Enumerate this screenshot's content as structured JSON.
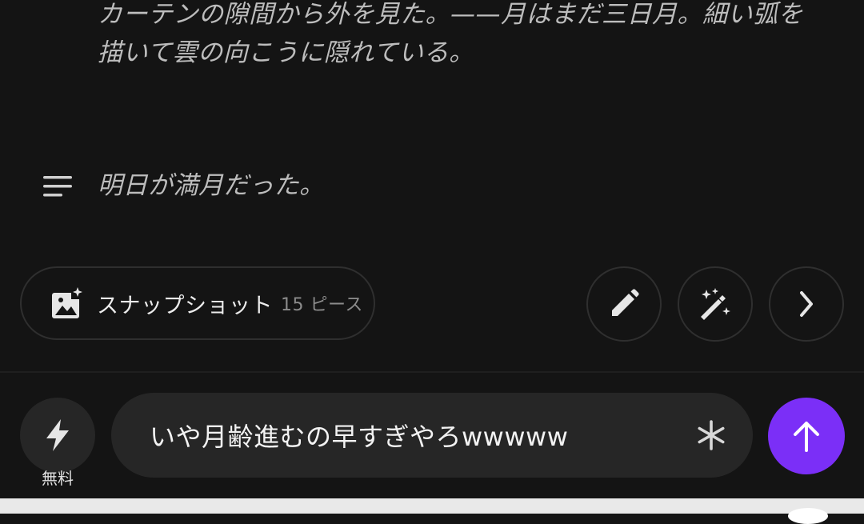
{
  "story": {
    "paragraph1": "カーテンの隙間から外を見た。——月はまだ三日月。細い弧を描いて雲の向こうに隠れている。",
    "paragraph2": "明日が満月だった。",
    "paragraph2_icon": "lines-icon"
  },
  "toolbar": {
    "snapshot": {
      "icon": "image-sparkle-icon",
      "label": "スナップショット",
      "count": "15 ピース"
    },
    "edit_icon": "pencil-icon",
    "magic_icon": "magic-wand-icon",
    "next_icon": "chevron-right-icon"
  },
  "composer": {
    "mode_icon": "lightning-icon",
    "mode_label": "無料",
    "input_value": "いや月齢進むの早すぎやろwwwww",
    "asterisk_icon": "asterisk-icon",
    "send_icon": "arrow-up-icon",
    "send_color": "#7b2ff7"
  }
}
